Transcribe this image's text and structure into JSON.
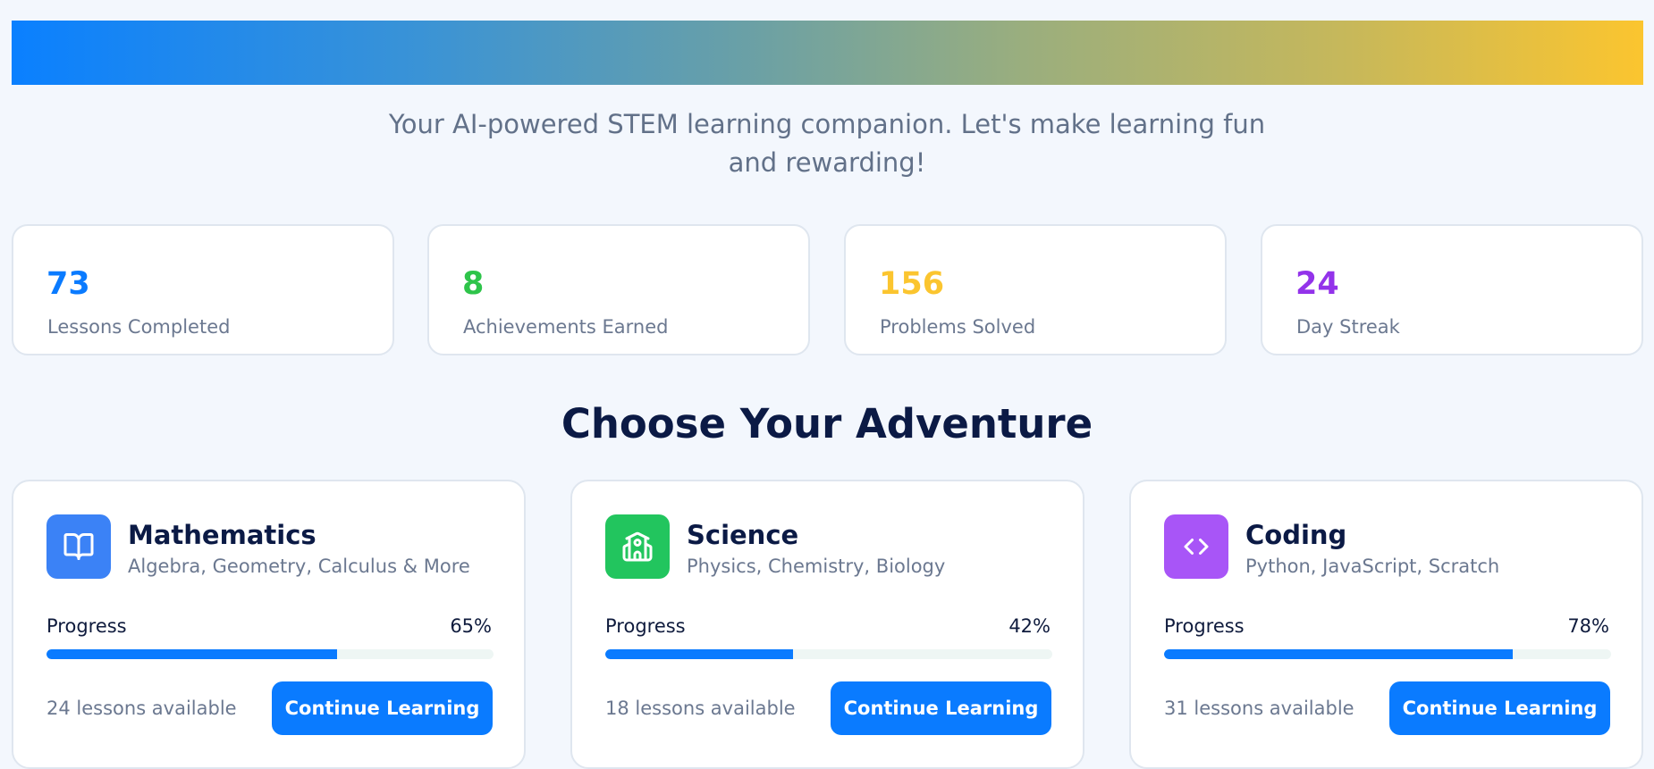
{
  "tagline": "Your AI-powered STEM learning companion. Let's make learning fun and rewarding!",
  "colors": {
    "accent_blue": "#0a7bff",
    "green": "#2ec44a",
    "yellow": "#fbc52f",
    "purple": "#9333ea"
  },
  "stats": [
    {
      "value": "73",
      "label": "Lessons Completed",
      "color": "#0a7bff"
    },
    {
      "value": "8",
      "label": "Achievements Earned",
      "color": "#2ec44a"
    },
    {
      "value": "156",
      "label": "Problems Solved",
      "color": "#fbc52f"
    },
    {
      "value": "24",
      "label": "Day Streak",
      "color": "#9333ea"
    }
  ],
  "section_title": "Choose Your Adventure",
  "subjects": [
    {
      "name": "Mathematics",
      "topics": "Algebra, Geometry, Calculus & More",
      "icon": "book-icon",
      "icon_color": "#3b82f6",
      "progress_label": "Progress",
      "progress": 65,
      "progress_text": "65%",
      "lessons_available": "24 lessons available",
      "button_label": "Continue Learning"
    },
    {
      "name": "Science",
      "topics": "Physics, Chemistry, Biology",
      "icon": "school-building-icon",
      "icon_color": "#22c55e",
      "progress_label": "Progress",
      "progress": 42,
      "progress_text": "42%",
      "lessons_available": "18 lessons available",
      "button_label": "Continue Learning"
    },
    {
      "name": "Coding",
      "topics": "Python, JavaScript, Scratch",
      "icon": "code-brackets-icon",
      "icon_color": "#a855f7",
      "progress_label": "Progress",
      "progress": 78,
      "progress_text": "78%",
      "lessons_available": "31 lessons available",
      "button_label": "Continue Learning"
    }
  ]
}
